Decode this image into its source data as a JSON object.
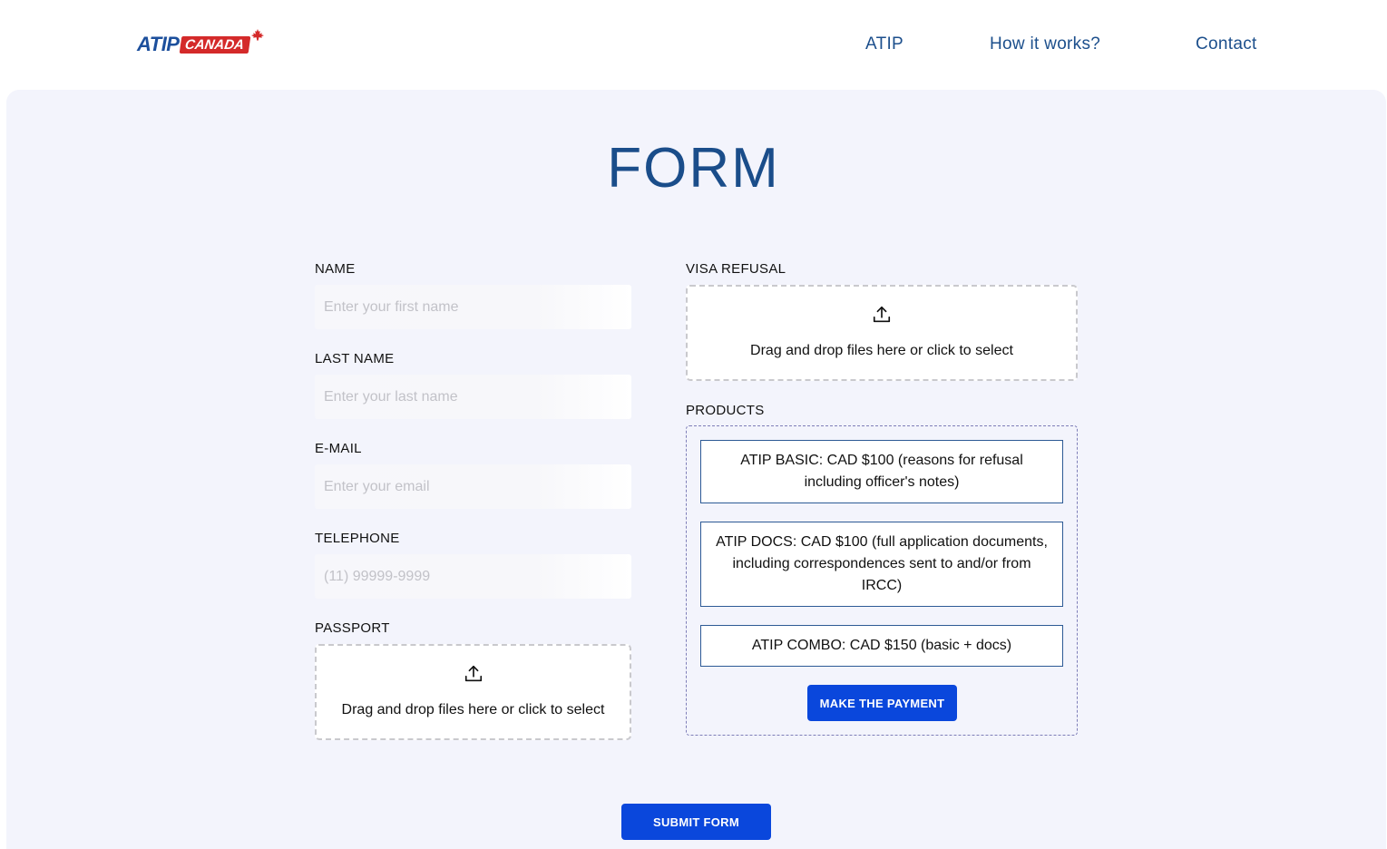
{
  "header": {
    "logo": {
      "part1": "ATIP",
      "part2": "CANADA"
    },
    "nav": [
      {
        "label": "ATIP"
      },
      {
        "label": "How it works?"
      },
      {
        "label": "Contact"
      }
    ]
  },
  "form": {
    "title": "FORM",
    "fields": {
      "name": {
        "label": "NAME",
        "placeholder": "Enter your first name"
      },
      "last_name": {
        "label": "LAST NAME",
        "placeholder": "Enter your last name"
      },
      "email": {
        "label": "E-MAIL",
        "placeholder": "Enter your email"
      },
      "telephone": {
        "label": "TELEPHONE",
        "placeholder": "(11) 99999-9999"
      }
    },
    "passport": {
      "label": "PASSPORT",
      "dropzone_text": "Drag and drop files here or click to select",
      "icon": "upload-icon"
    },
    "visa_refusal": {
      "label": "VISA REFUSAL",
      "dropzone_text": "Drag and drop files here or click to select",
      "icon": "upload-icon"
    },
    "products": {
      "label": "PRODUCTS",
      "items": [
        {
          "text": "ATIP BASIC: CAD $100 (reasons for refusal including officer's notes)"
        },
        {
          "text": "ATIP DOCS: CAD $100 (full application documents, including correspondences sent to and/or from IRCC)"
        },
        {
          "text": "ATIP COMBO: CAD $150 (basic + docs)"
        }
      ],
      "payment_button": "MAKE THE PAYMENT"
    },
    "submit_button": "SUBMIT FORM"
  },
  "colors": {
    "brand_blue": "#1c4f8c",
    "button_blue": "#0a47dc",
    "logo_red": "#d42a2a",
    "panel_bg": "#f3f4fc"
  }
}
